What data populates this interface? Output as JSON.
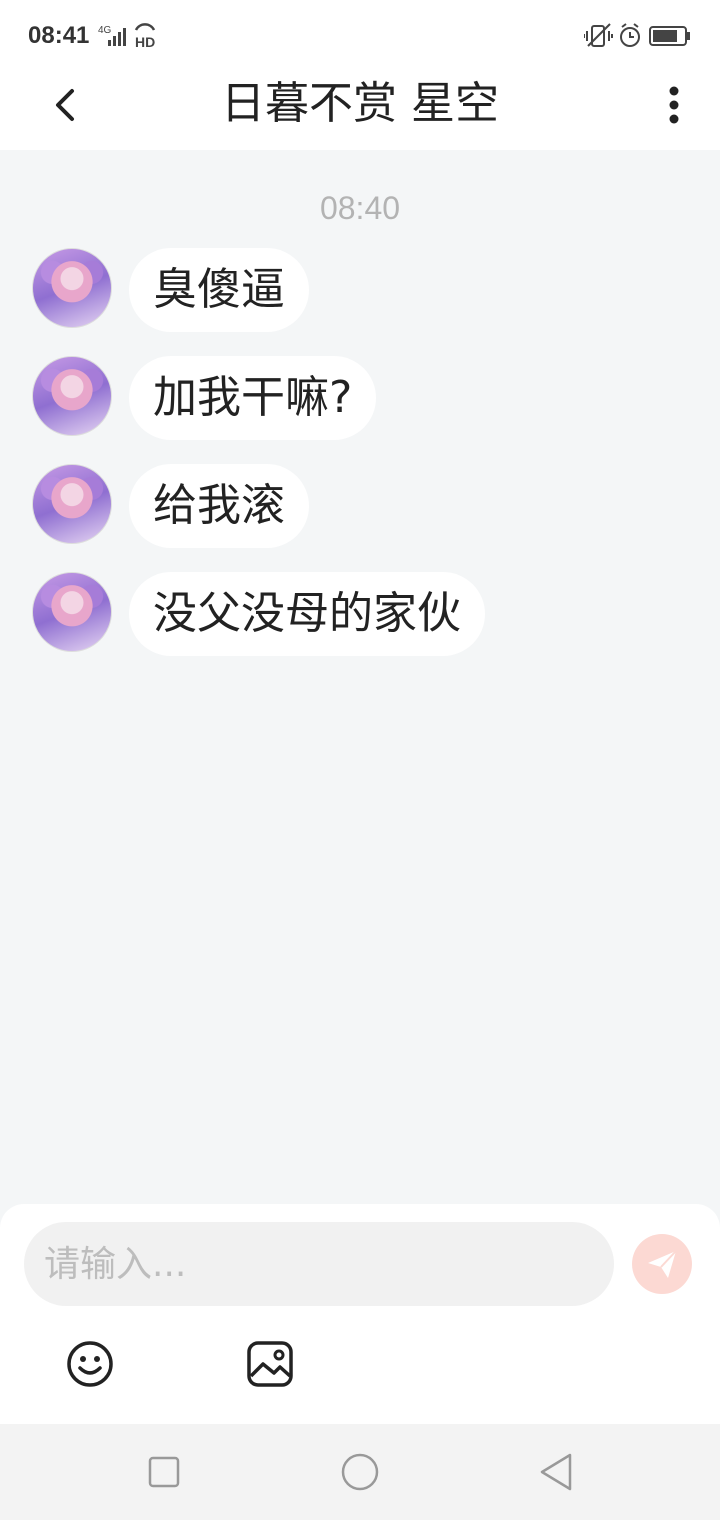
{
  "status_bar": {
    "time": "08:41",
    "network_label": "4G",
    "hd_label": "HD",
    "icons": [
      "signal-icon",
      "wifi-hd-icon",
      "vibrate-icon",
      "alarm-icon",
      "battery-icon"
    ]
  },
  "header": {
    "title": "日暮不赏 星空",
    "back_icon": "chevron-left-icon",
    "more_icon": "more-vertical-icon"
  },
  "chat": {
    "timestamp": "08:40",
    "messages": [
      {
        "text": "臭傻逼"
      },
      {
        "text": "加我干嘛?"
      },
      {
        "text": "给我滚"
      },
      {
        "text": "没父没母的家伙"
      }
    ]
  },
  "composer": {
    "placeholder": "请输入...",
    "send_icon": "send-icon",
    "send_color": "#f2826e",
    "tools": [
      "emoji-icon",
      "image-icon"
    ]
  },
  "nav": {
    "icons": [
      "recent-apps-icon",
      "home-icon",
      "back-icon"
    ]
  }
}
